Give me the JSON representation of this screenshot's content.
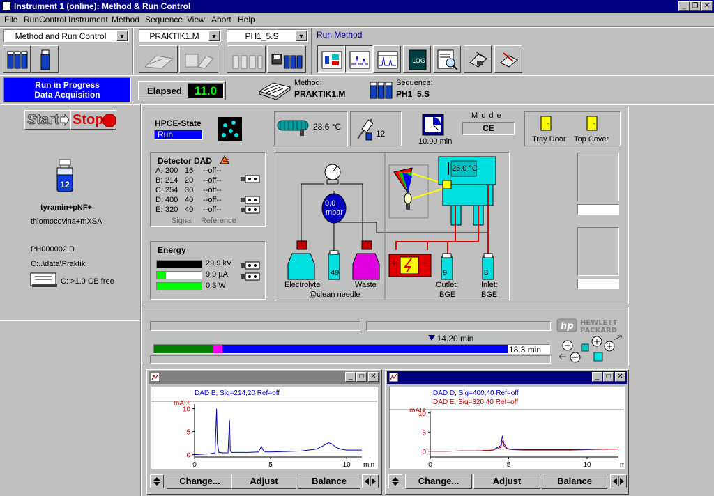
{
  "window": {
    "title": "Instrument 1 (online): Method & Run Control"
  },
  "menu": [
    "File",
    "RunControl",
    "Instrument",
    "Method",
    "Sequence",
    "View",
    "Abort",
    "Help"
  ],
  "toolbar": {
    "view_combo": "Method and Run Control",
    "method_combo": "PRAKTIK1.M",
    "sequence_combo": "PH1_5.S",
    "run_method_label": "Run Method"
  },
  "status": {
    "line1": "Run in Progress",
    "line2": "Data Acquisition",
    "elapsed_label": "Elapsed",
    "elapsed_value": "11.0",
    "method_label": "Method:",
    "method_value": "PRAKTIK1.M",
    "sequence_label": "Sequence:",
    "sequence_value": "PH1_5.S"
  },
  "left": {
    "start_label": "Start",
    "stop_label": "Stop",
    "vial_number": "12",
    "sample_name": "tyramin+pNF+",
    "sample_info": "thiomocovina+mXSA",
    "datafile": "PH000002.D",
    "datapath": "C:..\\data\\Praktik",
    "disk_free": "C: >1.0 GB free"
  },
  "hpce": {
    "title": "HPCE-State",
    "state": "Run",
    "temperature": "28.6 °C",
    "injector_count": "12",
    "time_value": "10.99 min",
    "mode_label": "M o d e",
    "mode_value": "CE",
    "tray_door": "Tray Door",
    "top_cover": "Top Cover"
  },
  "detector": {
    "title": "Detector DAD",
    "rows": [
      {
        "ch": "A:",
        "sig": "200",
        "bw": "16",
        "ref": "--off--"
      },
      {
        "ch": "B:",
        "sig": "214",
        "bw": "20",
        "ref": "--off--"
      },
      {
        "ch": "C:",
        "sig": "254",
        "bw": "30",
        "ref": "--off--"
      },
      {
        "ch": "D:",
        "sig": "400",
        "bw": "40",
        "ref": "--off--"
      },
      {
        "ch": "E:",
        "sig": "320",
        "bw": "40",
        "ref": "--off--"
      }
    ],
    "signal_label": "Signal",
    "reference_label": "Reference"
  },
  "energy": {
    "title": "Energy",
    "items": [
      {
        "value": "29.9 kV",
        "fill": 1.0,
        "color": "#000000"
      },
      {
        "value": "9.9 µA",
        "fill": 0.2,
        "color": "#00ff00"
      },
      {
        "value": "0.3 W",
        "fill": 1.0,
        "color": "#00ff00"
      }
    ]
  },
  "schematic": {
    "pressure_top": "0.0",
    "pressure_unit": "mbar",
    "vial_49": "49",
    "cassette_temp": "25.0 °C",
    "electrolyte": "Electrolyte",
    "waste": "Waste",
    "clean_needle": "@clean needle",
    "outlet_vial": "9",
    "inlet_vial": "8",
    "outlet": "Outlet:",
    "inlet": "Inlet:",
    "bge1": "BGE",
    "bge2": "BGE"
  },
  "progress": {
    "marker_label": "14.20 min",
    "end_label": "18.3 min",
    "marker_fraction": 0.776,
    "green_fraction": 0.15,
    "magenta_fraction": 0.022,
    "hp_line1": "HEWLETT",
    "hp_line2": "PACKARD",
    "hp_logo": "hp"
  },
  "chart1": {
    "legend": [
      "DAD B, Sig=214,20 Ref=off"
    ],
    "ylabel": "mAU",
    "xlabel": "min",
    "buttons": [
      "Change...",
      "Adjust",
      "Balance"
    ]
  },
  "chart2": {
    "legend": [
      "DAD D, Sig=400,40 Ref=off",
      "DAD E, Sig=320,40 Ref=off"
    ],
    "ylabel": "mAU",
    "xlabel": "min",
    "buttons": [
      "Change...",
      "Adjust",
      "Balance"
    ]
  },
  "chart_data": [
    {
      "type": "line",
      "x_ticks": [
        0,
        5,
        10
      ],
      "y_ticks": [
        0,
        5,
        10
      ],
      "xlim": [
        0,
        11
      ],
      "ylim": [
        -0.5,
        11
      ],
      "series": [
        {
          "name": "DAD B, Sig=214,20 Ref=off",
          "color": "#0000c0",
          "x": [
            0,
            0.5,
            1.0,
            1.35,
            1.45,
            1.5,
            1.6,
            1.8,
            2.2,
            2.3,
            2.35,
            2.45,
            2.7,
            3.5,
            4.2,
            4.4,
            4.5,
            4.65,
            5,
            6,
            7,
            8,
            8.5,
            8.8,
            9.0,
            9.3,
            9.6,
            10,
            11
          ],
          "y": [
            0,
            0.1,
            0.2,
            0.4,
            10,
            2.5,
            0.5,
            0.4,
            0.4,
            7.5,
            0.8,
            0.5,
            0.5,
            0.5,
            0.6,
            1.8,
            1.0,
            0.6,
            0.6,
            0.7,
            0.8,
            1.2,
            2.0,
            2.6,
            2.4,
            1.6,
            1.2,
            1.0,
            1.0
          ]
        }
      ]
    },
    {
      "type": "line",
      "x_ticks": [
        0,
        5,
        10
      ],
      "y_ticks": [
        0,
        5,
        10
      ],
      "xlim": [
        0,
        12
      ],
      "ylim": [
        -1.5,
        10.5
      ],
      "series": [
        {
          "name": "DAD D, Sig=400,40 Ref=off",
          "color": "#0000c0",
          "x": [
            0,
            1,
            2,
            3,
            4,
            4.5,
            4.6,
            4.7,
            4.9,
            5.2,
            6,
            7,
            8,
            9,
            10,
            11,
            12
          ],
          "y": [
            0,
            0,
            0.1,
            0.1,
            0.3,
            1.5,
            4.0,
            2.0,
            0.7,
            0.5,
            0.4,
            0.4,
            0.4,
            0.4,
            0.5,
            0.5,
            0.6
          ]
        },
        {
          "name": "DAD E, Sig=320,40 Ref=off",
          "color": "#c00000",
          "x": [
            0,
            1,
            2,
            3,
            4,
            4.5,
            4.6,
            4.7,
            4.9,
            5.2,
            6,
            7,
            8,
            9,
            10,
            11,
            12
          ],
          "y": [
            0,
            0,
            0.1,
            0.1,
            0.3,
            1.0,
            2.6,
            1.4,
            0.6,
            0.4,
            0.3,
            0.3,
            0.3,
            0.3,
            0.4,
            0.5,
            0.6
          ]
        }
      ]
    }
  ]
}
